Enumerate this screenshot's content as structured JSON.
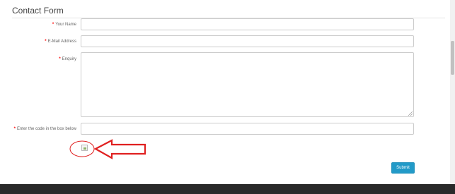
{
  "form": {
    "legend": "Contact Form",
    "required_marker": "*",
    "fields": {
      "name": {
        "label": "Your Name",
        "value": ""
      },
      "email": {
        "label": "E-Mail Address",
        "value": ""
      },
      "enquiry": {
        "label": "Enquiry",
        "value": ""
      },
      "captcha": {
        "label": "Enter the code in the box below",
        "value": ""
      }
    },
    "submit_label": "Submit"
  },
  "colors": {
    "accent": "#229ac8",
    "required": "#ff0000",
    "annotation": "#e02020",
    "footer": "#2a2a2a"
  },
  "icons": {
    "captcha": "broken-image-icon",
    "annotation_arrow": "left-arrow-icon"
  }
}
